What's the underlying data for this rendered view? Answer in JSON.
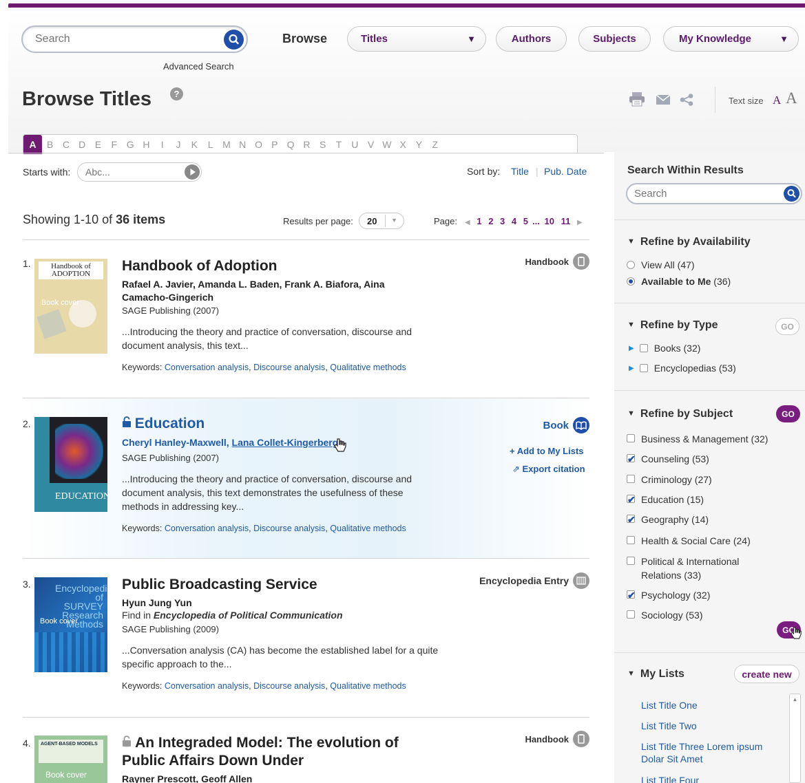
{
  "header": {
    "search_placeholder": "Search",
    "advanced_search": "Advanced Search",
    "browse_label": "Browse",
    "nav": [
      {
        "label": "Titles"
      },
      {
        "label": "Authors"
      },
      {
        "label": "Subjects"
      },
      {
        "label": "My Knowledge"
      }
    ],
    "caret": "▼"
  },
  "page": {
    "title": "Browse Titles",
    "help": "?",
    "text_size_label": "Text size",
    "text_size_small": "A",
    "text_size_large": "A"
  },
  "alphabet": {
    "letters": [
      "A",
      "B",
      "C",
      "D",
      "E",
      "F",
      "G",
      "H",
      "I",
      "J",
      "K",
      "L",
      "M",
      "N",
      "O",
      "P",
      "Q",
      "R",
      "S",
      "T",
      "U",
      "V",
      "W",
      "X",
      "Y",
      "Z"
    ],
    "active": "A"
  },
  "filters": {
    "starts_with_label": "Starts with:",
    "starts_with_placeholder": "Abc...",
    "sort_by_label": "Sort by:",
    "sort_title": "Title",
    "sort_sep": "|",
    "sort_pub_date": "Pub. Date"
  },
  "summary": {
    "showing_prefix": "Showing 1-10 of",
    "showing_count": "36 items",
    "results_per_page_label": "Results per page:",
    "results_per_page_value": "20",
    "page_label": "Page:",
    "pages": [
      "1",
      "2",
      "3",
      "4",
      "5",
      "...",
      "10",
      "11"
    ],
    "prev_arrow": "◀",
    "next_arrow": "▶"
  },
  "results": [
    {
      "num": "1.",
      "title": "Handbook of Adoption",
      "authors": "Rafael A. Javier, Amanda L. Baden, Frank A. Biafora, Aina Camacho-Gingerich",
      "publisher": "SAGE Publishing (2007)",
      "snippet": "...Introducing the theory and practice of conversation, discourse and document analysis, this text...",
      "keywords_label": "Keywords:",
      "keywords": [
        "Conversation analysis",
        "Discourse analysis",
        "Qualitative methods"
      ],
      "type": "Handbook",
      "cover_title": "Handbook of ADOPTION",
      "cover_sub": "Book cover"
    },
    {
      "num": "2.",
      "title": "Education",
      "author_1": "Cheryl Hanley-Maxwell,",
      "author_2": "Lana Collet-Kingerberg",
      "publisher": "SAGE Publishing (2007)",
      "snippet": "...Introducing the theory and practice of conversation, discourse and document analysis, this text demonstrates the usefulness of these methods in addressing key...",
      "keywords_label": "Keywords:",
      "keywords": [
        "Conversation analysis",
        "Discourse analysis",
        "Qualitative methods"
      ],
      "type": "Book",
      "add_to_lists": "+ Add to My Lists",
      "export_citation": "Export citation",
      "cover_title": "EDUCATION"
    },
    {
      "num": "3.",
      "title": "Public Broadcasting Service",
      "authors": "Hyun Jung Yun",
      "find_in_prefix": "Find in",
      "find_in_title": "Encyclopedia of Political Communication",
      "publisher": "SAGE Publishing (2009)",
      "snippet": "...Conversation analysis (CA) has become the established label for a quite specific approach to the...",
      "keywords_label": "Keywords:",
      "keywords": [
        "Conversation analysis",
        "Discourse analysis",
        "Qualitative methods"
      ],
      "type": "Encyclopedia Entry",
      "cover_title": "Encyclopedia of SURVEY Research Methods",
      "cover_sub": "Book cover"
    },
    {
      "num": "4.",
      "title": "An Integraded Model: The evolution of Public Affairs Down Under",
      "authors": "Rayner Prescott, Geoff Allen",
      "type": "Handbook",
      "cover_title": "AGENT-BASED MODELS",
      "cover_sub": "Book cover"
    }
  ],
  "sidebar": {
    "search_within_heading": "Search Within Results",
    "search_placeholder": "Search",
    "availability": {
      "heading": "Refine by Availability",
      "options": [
        {
          "label": "View All",
          "count": "(47)",
          "selected": false
        },
        {
          "label": "Available to Me",
          "count": "(36)",
          "selected": true
        }
      ]
    },
    "type": {
      "heading": "Refine by Type",
      "go": "GO",
      "options": [
        {
          "label": "Books (32)"
        },
        {
          "label": "Encyclopedias (53)"
        }
      ]
    },
    "subject": {
      "heading": "Refine by Subject",
      "go": "GO",
      "options": [
        {
          "label": "Business & Management (32)",
          "checked": false
        },
        {
          "label": "Counseling (53)",
          "checked": true
        },
        {
          "label": "Criminology (27)",
          "checked": false
        },
        {
          "label": "Education (15)",
          "checked": true
        },
        {
          "label": "Geography (14)",
          "checked": true
        },
        {
          "label": "Health & Social Care (24)",
          "checked": false
        },
        {
          "label": "Political & International Relations  (33)",
          "checked": false
        },
        {
          "label": "Psychology (32)",
          "checked": true
        },
        {
          "label": "Sociology (53)",
          "checked": false
        }
      ]
    },
    "my_lists": {
      "heading": "My Lists",
      "create_new": "create new",
      "items": [
        "List Title One",
        "List Title Two",
        "List Title Three Lorem ipsum Dolar Sit Amet",
        "List Title Four"
      ]
    }
  },
  "colors": {
    "brand_purple": "#6e1a72",
    "link_blue": "#1f5aa6",
    "search_blue": "#1f4fa8"
  }
}
